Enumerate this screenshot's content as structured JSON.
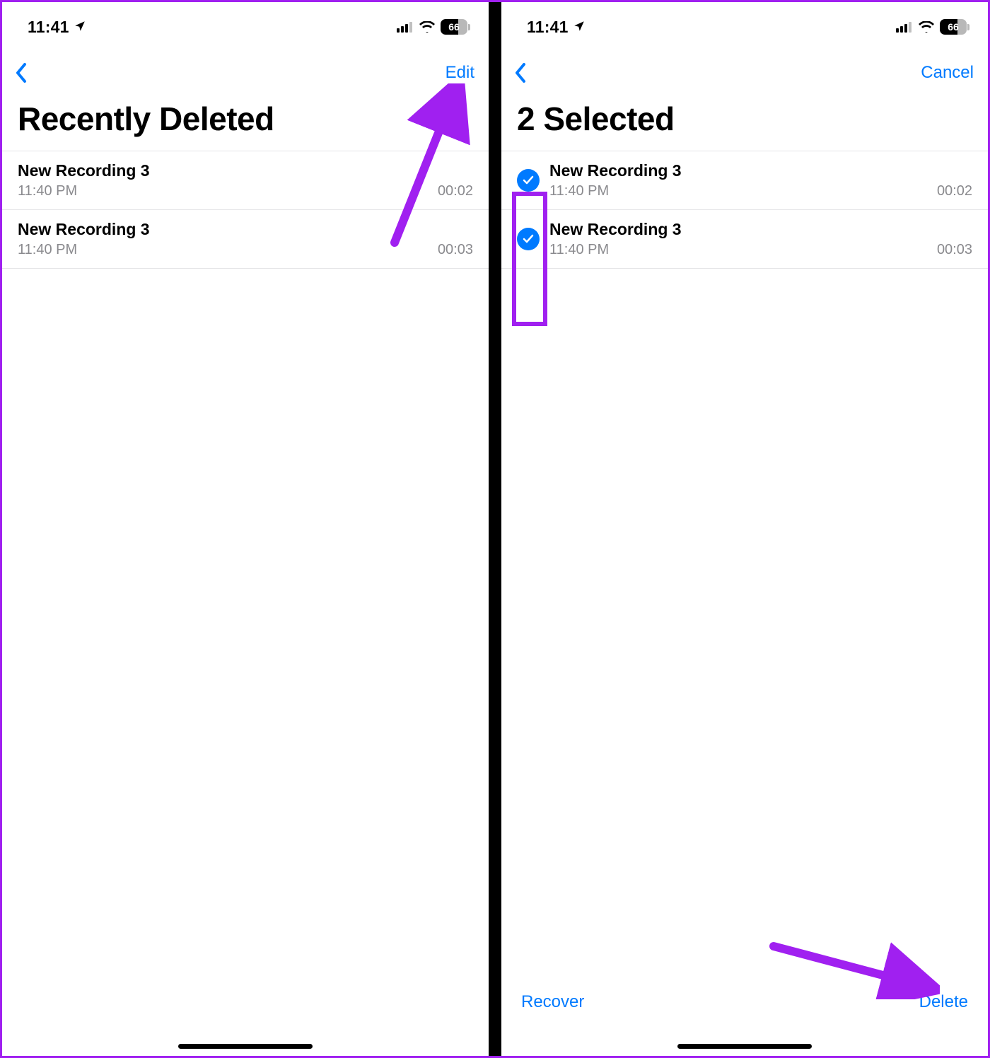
{
  "status": {
    "time": "11:41",
    "battery_percent": "66"
  },
  "left": {
    "nav_action": "Edit",
    "title": "Recently Deleted",
    "items": [
      {
        "title": "New Recording 3",
        "time": "11:40 PM",
        "duration": "00:02"
      },
      {
        "title": "New Recording 3",
        "time": "11:40 PM",
        "duration": "00:03"
      }
    ]
  },
  "right": {
    "nav_action": "Cancel",
    "title": "2 Selected",
    "items": [
      {
        "title": "New Recording 3",
        "time": "11:40 PM",
        "duration": "00:02"
      },
      {
        "title": "New Recording 3",
        "time": "11:40 PM",
        "duration": "00:03"
      }
    ],
    "bottom_left": "Recover",
    "bottom_right": "Delete"
  },
  "colors": {
    "accent": "#007aff",
    "annotation": "#a020f0"
  }
}
